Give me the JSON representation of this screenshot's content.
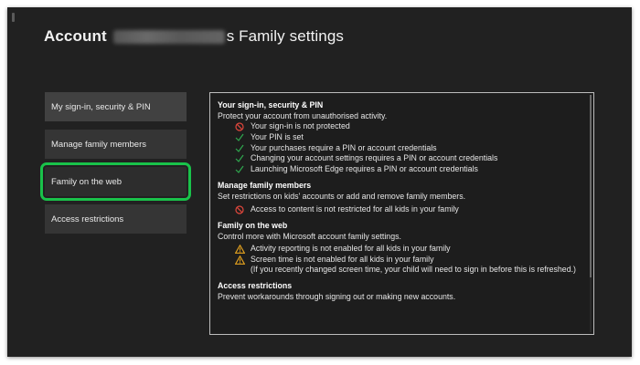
{
  "header": {
    "title_prefix": "Account",
    "title_suffix": "s Family settings"
  },
  "sidebar": {
    "items": [
      {
        "label": "My sign-in, security & PIN"
      },
      {
        "label": "Manage family members"
      },
      {
        "label": "Family on the web"
      },
      {
        "label": "Access restrictions"
      }
    ]
  },
  "content": {
    "sections": [
      {
        "title": "Your sign-in, security & PIN",
        "description": "Protect your account from unauthorised activity.",
        "rows": [
          {
            "icon": "blocked-icon",
            "text": "Your sign-in is not protected"
          },
          {
            "icon": "checkmark-icon",
            "text": "Your PIN is set"
          },
          {
            "icon": "checkmark-icon",
            "text": "Your purchases require a PIN or account credentials"
          },
          {
            "icon": "checkmark-icon",
            "text": "Changing your account settings requires a PIN or account credentials"
          },
          {
            "icon": "checkmark-icon",
            "text": "Launching Microsoft Edge requires a PIN or account credentials"
          }
        ]
      },
      {
        "title": "Manage family members",
        "description": "Set restrictions on kids' accounts or add and remove family members.",
        "rows": [
          {
            "icon": "blocked-icon",
            "text": "Access to content is not restricted for all kids in your family"
          }
        ]
      },
      {
        "title": "Family on the web",
        "description": "Control more with Microsoft account family settings.",
        "rows": [
          {
            "icon": "warning-icon",
            "text": "Activity reporting is not enabled for all kids in your family"
          },
          {
            "icon": "warning-icon",
            "text": "Screen time is not enabled for all kids in your family"
          },
          {
            "icon": "",
            "text": "(If you recently changed screen time, your child will need to sign in before this is refreshed.)"
          }
        ]
      },
      {
        "title": "Access restrictions",
        "description": "Prevent workarounds through signing out or making new accounts.",
        "rows": []
      }
    ]
  },
  "colors": {
    "background": "#212121",
    "panel": "#353535",
    "focus_outline": "#19c24a",
    "blocked": "#e0473c",
    "check": "#2fa84f",
    "warning": "#e6a31e"
  }
}
